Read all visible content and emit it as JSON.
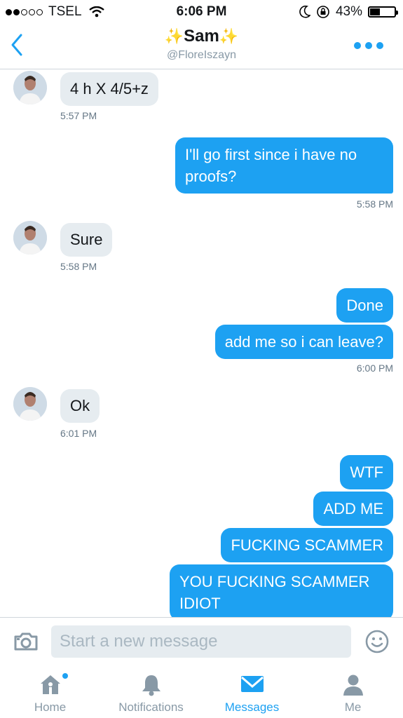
{
  "status_bar": {
    "carrier": "TSEL",
    "time": "6:06 PM",
    "battery": "43%"
  },
  "header": {
    "name": "Sam",
    "sparkle": "✨",
    "handle": "@FloreIszayn"
  },
  "messages": [
    {
      "dir": "in",
      "text": "4 h X 4/5+z",
      "time": "5:57 PM"
    },
    {
      "dir": "out",
      "text": "I'll go first since i have no proofs?",
      "time": "5:58 PM"
    },
    {
      "dir": "in",
      "text": "Sure",
      "time": "5:58 PM"
    },
    {
      "dir": "out",
      "text": "Done"
    },
    {
      "dir": "out",
      "text": "add me so i can leave?",
      "time": "6:00 PM"
    },
    {
      "dir": "in",
      "text": "Ok",
      "time": "6:01 PM"
    },
    {
      "dir": "out",
      "text": "WTF"
    },
    {
      "dir": "out",
      "text": "ADD ME"
    },
    {
      "dir": "out",
      "text": "FUCKING SCAMMER"
    },
    {
      "dir": "out",
      "text": "YOU FUCKING SCAMMER IDIOT"
    }
  ],
  "composer": {
    "placeholder": "Start a new message"
  },
  "tabs": [
    {
      "label": "Home",
      "icon": "home-icon"
    },
    {
      "label": "Notifications",
      "icon": "bell-icon"
    },
    {
      "label": "Messages",
      "icon": "envelope-icon",
      "active": true
    },
    {
      "label": "Me",
      "icon": "person-icon"
    }
  ],
  "colors": {
    "accent": "#1da1f2",
    "incoming_bubble": "#e6ecf0"
  }
}
